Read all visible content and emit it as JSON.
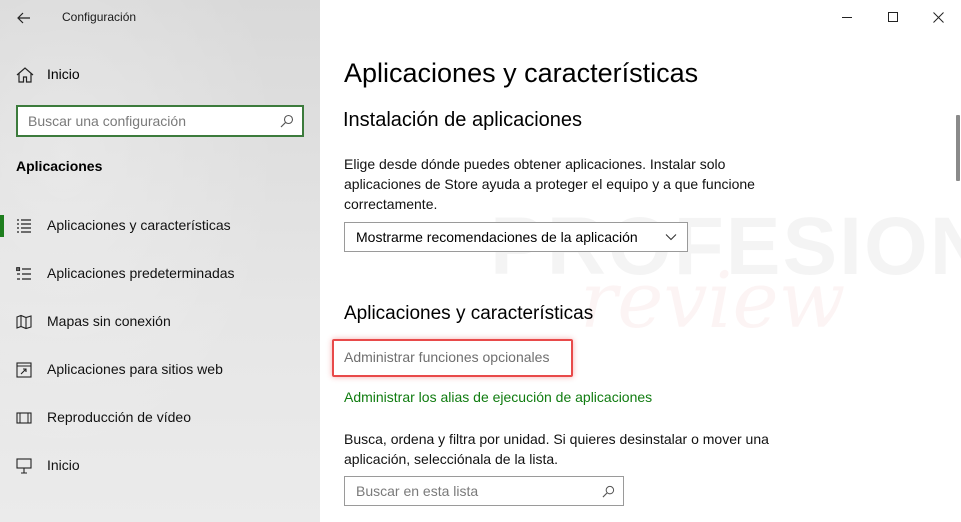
{
  "window": {
    "title": "Configuración",
    "controls": {
      "minimize": "minimize-icon",
      "maximize": "maximize-icon",
      "close": "close-icon"
    }
  },
  "sidebar": {
    "home_label": "Inicio",
    "search_placeholder": "Buscar una configuración",
    "section_title": "Aplicaciones",
    "items": [
      {
        "label": "Aplicaciones y características",
        "icon": "apps-list-icon",
        "active": true
      },
      {
        "label": "Aplicaciones predeterminadas",
        "icon": "default-apps-icon",
        "active": false
      },
      {
        "label": "Mapas sin conexión",
        "icon": "map-icon",
        "active": false
      },
      {
        "label": "Aplicaciones para sitios web",
        "icon": "web-apps-icon",
        "active": false
      },
      {
        "label": "Reproducción de vídeo",
        "icon": "video-icon",
        "active": false
      },
      {
        "label": "Inicio",
        "icon": "startup-icon",
        "active": false
      }
    ]
  },
  "main": {
    "title": "Aplicaciones y características",
    "install_section": {
      "heading": "Instalación de aplicaciones",
      "description": "Elige desde dónde puedes obtener aplicaciones. Instalar solo aplicaciones de Store ayuda a proteger el equipo y a que funcione correctamente.",
      "dropdown_value": "Mostrarme recomendaciones de la aplicación"
    },
    "apps_section": {
      "heading": "Aplicaciones y características",
      "link_optional": "Administrar funciones opcionales",
      "link_alias": "Administrar los alias de ejecución de aplicaciones",
      "description": "Busca, ordena y filtra por unidad. Si quieres desinstalar o mover una aplicación, selecciónala de la lista.",
      "search_placeholder": "Buscar en esta lista"
    },
    "watermark": {
      "line1": "PROFESIONAL",
      "line2": "review"
    }
  },
  "colors": {
    "accent_green": "#107c10",
    "active_bar": "#1e7e1e",
    "highlight_red": "#e84a4a"
  }
}
